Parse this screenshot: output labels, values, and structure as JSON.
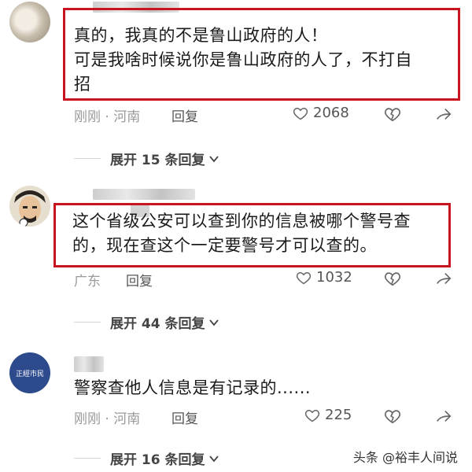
{
  "comments": [
    {
      "text_lines": [
        "真的，我真的不是鲁山政府的人！",
        "可是我啥时候说你是鲁山政府的人了，不打自",
        "招"
      ],
      "time_location": "刚刚 · 河南",
      "reply_label": "回复",
      "likes": "2068",
      "expand_label": "展开 15 条回复"
    },
    {
      "text_lines": [
        "这个省级公安可以查到你的信息被哪个警号查",
        "的，现在查这个一定要警号才可以查的。"
      ],
      "time_location": "广东",
      "reply_label": "回复",
      "likes": "1032",
      "expand_label": "展开 44 条回复"
    },
    {
      "text_lines": [
        "警察查他人信息是有记录的......"
      ],
      "time_location": "刚刚 · 河南",
      "reply_label": "回复",
      "likes": "225",
      "expand_label": "展开 16 条回复"
    }
  ],
  "avatar3_text": "正經市民",
  "watermark": "头条 @裕丰人间说",
  "colors": {
    "highlight": "#c8141e",
    "meta": "#9a9a9a",
    "text": "#1b1b1b"
  },
  "icons": [
    "heart-icon",
    "broken-heart-icon",
    "share-icon",
    "chevron-down-icon"
  ]
}
